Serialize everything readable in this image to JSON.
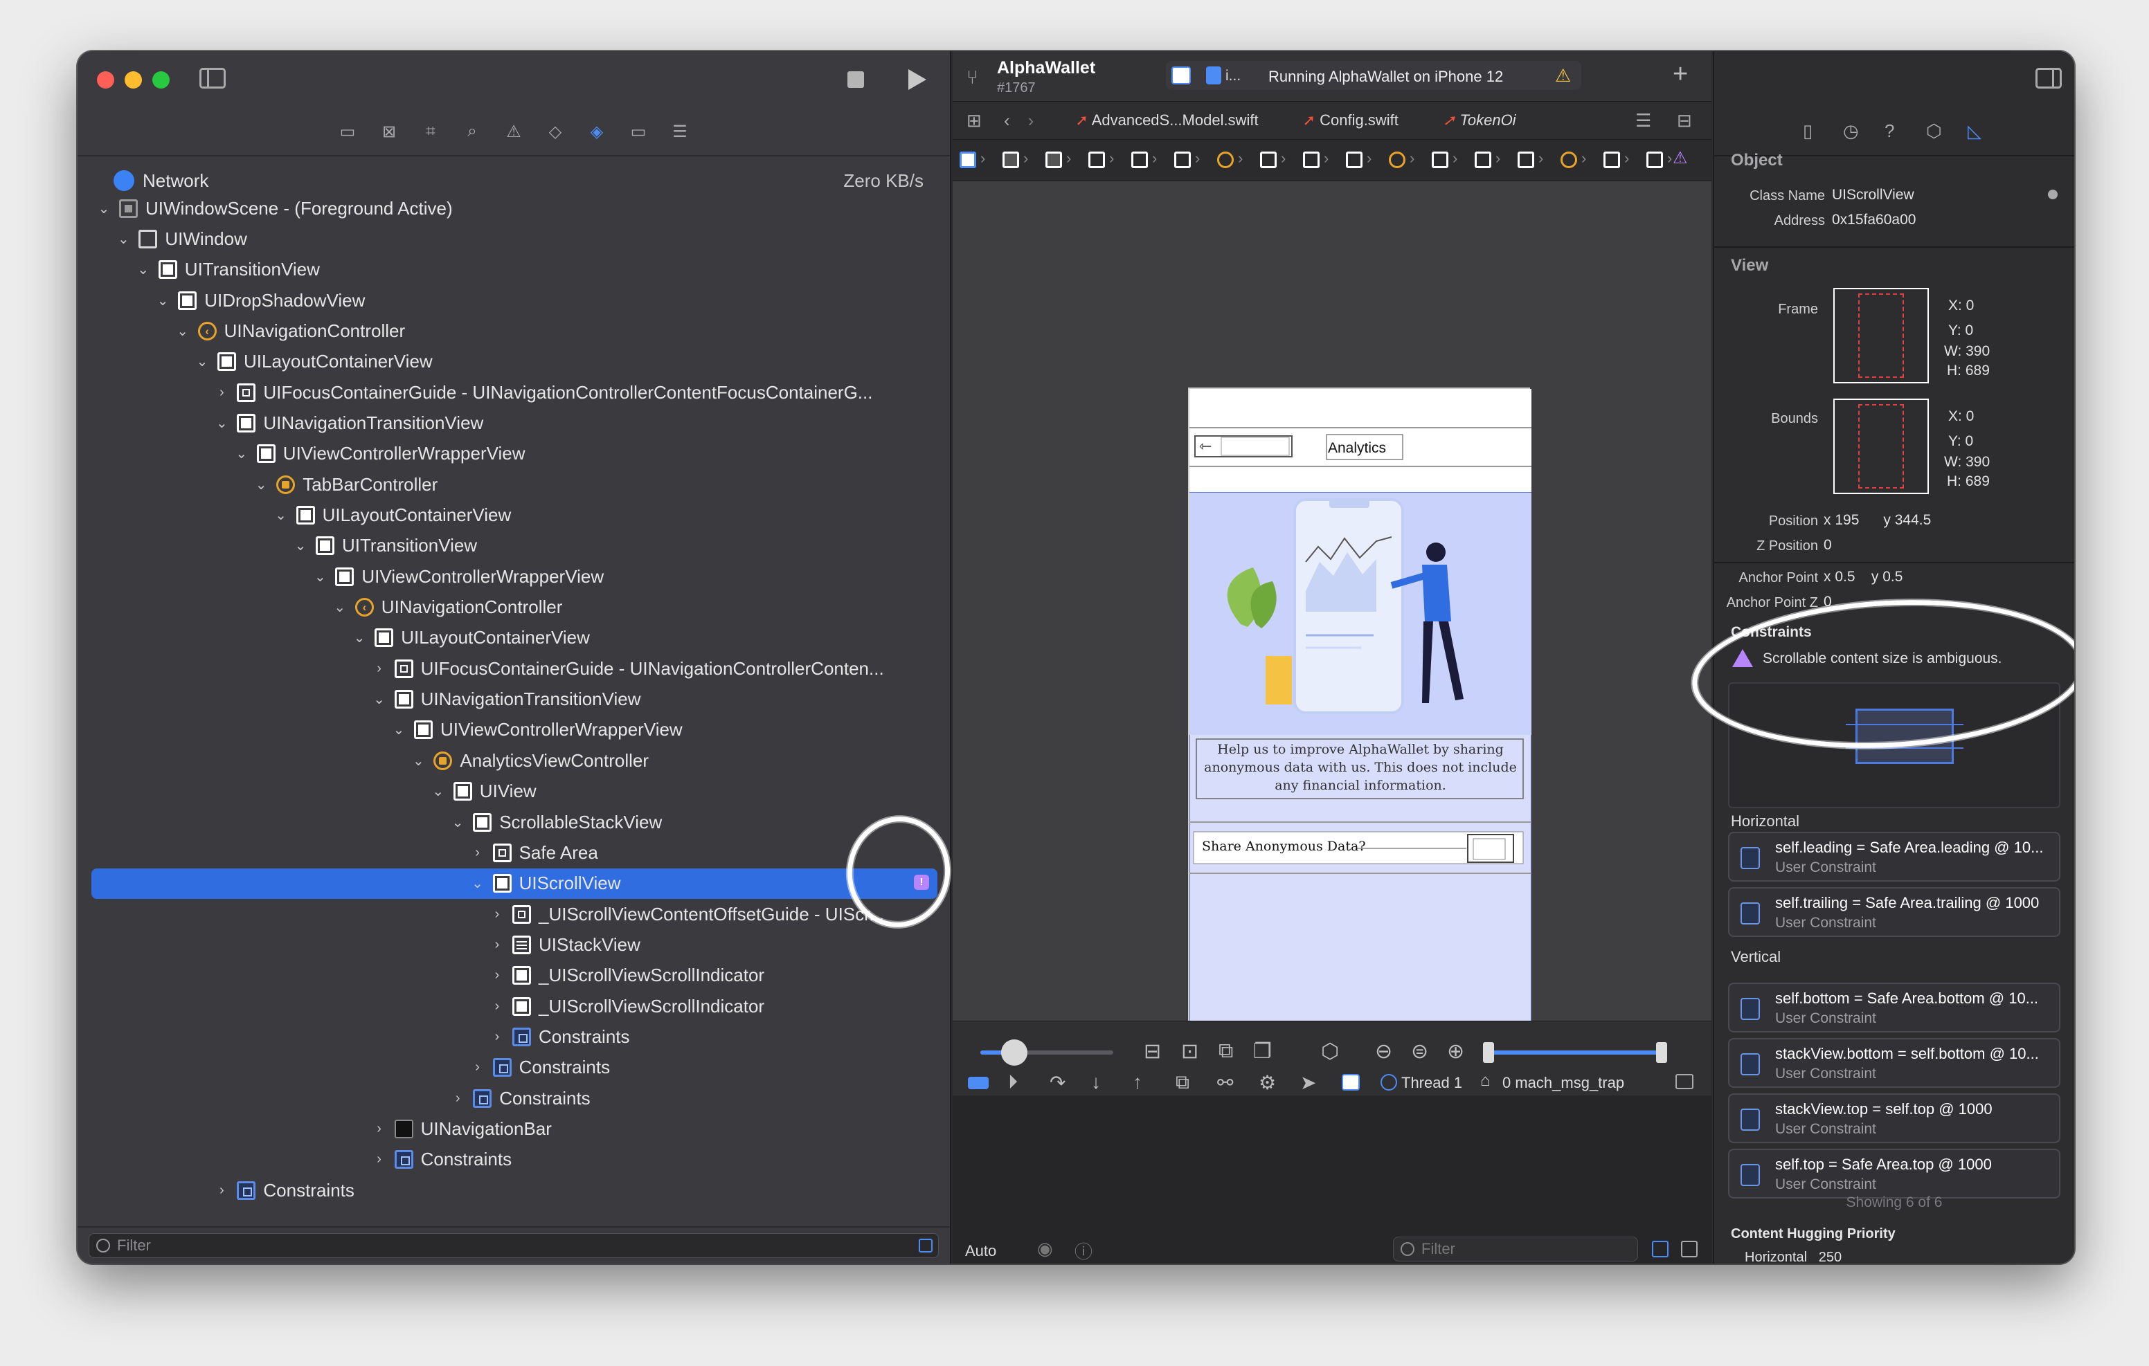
{
  "window": {
    "scheme": "AlphaWallet",
    "build": "#1767",
    "status": "Running AlphaWallet on iPhone 12",
    "scheme_target": "i..."
  },
  "left": {
    "network_label": "Network",
    "network_value": "Zero KB/s",
    "filter_placeholder": "Filter",
    "tree": [
      {
        "label": "UIWindowScene - (Foreground Active)",
        "depth": 0,
        "icon": "scene-icon",
        "open": true
      },
      {
        "label": "UIWindow",
        "depth": 1,
        "icon": "window-icon",
        "open": true
      },
      {
        "label": "UITransitionView",
        "depth": 2,
        "icon": "view-icon",
        "open": true
      },
      {
        "label": "UIDropShadowView",
        "depth": 3,
        "icon": "view-icon",
        "open": true
      },
      {
        "label": "UINavigationController",
        "depth": 4,
        "icon": "navigation-controller-icon",
        "open": true
      },
      {
        "label": "UILayoutContainerView",
        "depth": 5,
        "icon": "view-icon",
        "open": true
      },
      {
        "label": "UIFocusContainerGuide - UINavigationControllerContentFocusContainerG...",
        "depth": 6,
        "icon": "guide-icon",
        "open": false
      },
      {
        "label": "UINavigationTransitionView",
        "depth": 6,
        "icon": "view-icon",
        "open": true
      },
      {
        "label": "UIViewControllerWrapperView",
        "depth": 7,
        "icon": "view-icon",
        "open": true
      },
      {
        "label": "TabBarController",
        "depth": 8,
        "icon": "tabbar-controller-icon",
        "open": true
      },
      {
        "label": "UILayoutContainerView",
        "depth": 9,
        "icon": "view-icon",
        "open": true
      },
      {
        "label": "UITransitionView",
        "depth": 10,
        "icon": "view-icon",
        "open": true
      },
      {
        "label": "UIViewControllerWrapperView",
        "depth": 11,
        "icon": "view-icon",
        "open": true
      },
      {
        "label": "UINavigationController",
        "depth": 12,
        "icon": "navigation-controller-icon",
        "open": true
      },
      {
        "label": "UILayoutContainerView",
        "depth": 13,
        "icon": "view-icon",
        "open": true
      },
      {
        "label": "UIFocusContainerGuide - UINavigationControllerConten...",
        "depth": 14,
        "icon": "guide-icon",
        "open": false
      },
      {
        "label": "UINavigationTransitionView",
        "depth": 14,
        "icon": "view-icon",
        "open": true
      },
      {
        "label": "UIViewControllerWrapperView",
        "depth": 15,
        "icon": "view-icon",
        "open": true
      },
      {
        "label": "AnalyticsViewController",
        "depth": 16,
        "icon": "view-controller-icon",
        "open": true
      },
      {
        "label": "UIView",
        "depth": 17,
        "icon": "view-icon",
        "open": true
      },
      {
        "label": "ScrollableStackView",
        "depth": 18,
        "icon": "view-icon",
        "open": true
      },
      {
        "label": "Safe Area",
        "depth": 19,
        "icon": "guide-icon",
        "open": false
      },
      {
        "label": "UIScrollView",
        "depth": 19,
        "icon": "view-icon",
        "open": true,
        "selected": true,
        "warning": true
      },
      {
        "label": "_UIScrollViewContentOffsetGuide - UIScr...",
        "depth": 20,
        "icon": "guide-icon",
        "open": false
      },
      {
        "label": "UIStackView",
        "depth": 20,
        "icon": "stack-icon",
        "open": false
      },
      {
        "label": "_UIScrollViewScrollIndicator",
        "depth": 20,
        "icon": "view-icon",
        "open": false
      },
      {
        "label": "_UIScrollViewScrollIndicator",
        "depth": 20,
        "icon": "view-icon",
        "open": false
      },
      {
        "label": "Constraints",
        "depth": 20,
        "icon": "constraints-icon",
        "open": false
      },
      {
        "label": "Constraints",
        "depth": 19,
        "icon": "constraints-icon",
        "open": false
      },
      {
        "label": "Constraints",
        "depth": 18,
        "icon": "constraints-icon",
        "open": false
      },
      {
        "label": "UINavigationBar",
        "depth": 14,
        "icon": "navigation-bar-icon",
        "open": false
      },
      {
        "label": "Constraints",
        "depth": 14,
        "icon": "constraints-icon",
        "open": false
      },
      {
        "label": "Constraints",
        "depth": 6,
        "icon": "constraints-icon",
        "open": false
      }
    ]
  },
  "tabs": [
    "AdvancedS...Model.swift",
    "Config.swift",
    "TokenOi"
  ],
  "phone": {
    "title": "Analytics",
    "description": "Help us to improve AlphaWallet by sharing anonymous data with us. This does not include any financial information.",
    "switch_label": "Share Anonymous Data?"
  },
  "debug": {
    "thread": "Thread 1",
    "frame": "0 mach_msg_trap",
    "auto": "Auto",
    "filter_placeholder": "Filter"
  },
  "inspector": {
    "object_header": "Object",
    "class_name_label": "Class Name",
    "class_name": "UIScrollView",
    "address_label": "Address",
    "address": "0x15fa60a00",
    "view_header": "View",
    "frame_label": "Frame",
    "frame": {
      "x": "X: 0",
      "y": "Y: 0",
      "w": "W: 390",
      "h": "H: 689"
    },
    "bounds_label": "Bounds",
    "bounds": {
      "x": "X: 0",
      "y": "Y: 0",
      "w": "W: 390",
      "h": "H: 689"
    },
    "position_label": "Position",
    "position": "x 195      y 344.5",
    "zposition_label": "Z Position",
    "zposition": "0",
    "anchor_label": "Anchor Point",
    "anchor": "x 0.5    y 0.5",
    "anchor_z_label": "Anchor Point Z",
    "anchor_z": "0",
    "constraints_header": "Constraints",
    "warning": "Scrollable content size is ambiguous.",
    "horizontal_header": "Horizontal",
    "vertical_header": "Vertical",
    "constraints": [
      {
        "group": "h",
        "text": "self.leading = Safe Area.leading @ 10...",
        "kind": "User Constraint"
      },
      {
        "group": "h",
        "text": "self.trailing = Safe Area.trailing @ 1000",
        "kind": "User Constraint"
      },
      {
        "group": "v",
        "text": "self.bottom = Safe Area.bottom @ 10...",
        "kind": "User Constraint"
      },
      {
        "group": "v",
        "text": "stackView.bottom = self.bottom @ 10...",
        "kind": "User Constraint"
      },
      {
        "group": "v",
        "text": "stackView.top = self.top @ 1000",
        "kind": "User Constraint"
      },
      {
        "group": "v",
        "text": "self.top = Safe Area.top @ 1000",
        "kind": "User Constraint"
      }
    ],
    "showing": "Showing 6 of 6",
    "hugging_header": "Content Hugging Priority",
    "hugging_horizontal": "Horizontal   250"
  },
  "colors": {
    "accent": "#2f6de0",
    "warning": "#b786ff",
    "controller": "#e8a42a"
  }
}
